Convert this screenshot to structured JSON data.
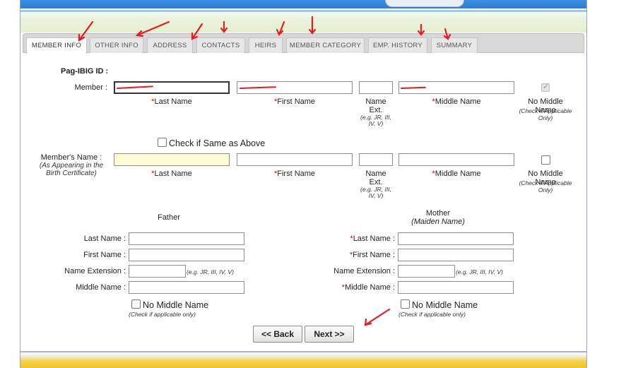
{
  "tabs": [
    {
      "label": "MEMBER INFO",
      "active": true
    },
    {
      "label": "OTHER INFO"
    },
    {
      "label": "ADDRESS"
    },
    {
      "label": "CONTACTS"
    },
    {
      "label": "HEIRS"
    },
    {
      "label": "MEMBER CATEGORY"
    },
    {
      "label": "EMP. HISTORY"
    },
    {
      "label": "SUMMARY"
    }
  ],
  "form": {
    "pagibig_label": "Pag-IBIG ID :",
    "member_label": "Member :",
    "member_values": {
      "last": "",
      "first": "",
      "ext": "",
      "middle": ""
    },
    "col_last": "Last Name",
    "col_first": "First Name",
    "col_ext": "Name Ext.",
    "col_ext_note": "(e.g. JR, III, IV, V)",
    "col_middle": "Middle Name",
    "req_mark": "*",
    "no_middle": "No Middle Name",
    "no_middle_note": "(Check if Applicable Only)",
    "same_as_above": "Check if Same as Above",
    "members_name_label": "Member's Name :",
    "members_name_note": "(As Appearing in the Birth Certificate)"
  },
  "parents": {
    "father_heading": "Father",
    "mother_heading": "Mother",
    "mother_note": "(Maiden Name)",
    "last_name": "Last Name :",
    "first_name": "First Name :",
    "name_ext": "Name Extension :",
    "middle_name": "Middle Name :",
    "ext_note": "(e.g. JR, III, IV, V)",
    "no_middle": "No Middle Name",
    "no_middle_note": "(Check if applicable only)"
  },
  "buttons": {
    "back": "<< Back",
    "next": "Next >>"
  },
  "colors": {
    "annotation_red": "#e8191f",
    "highlight_yellow": "#fffbd6",
    "header_blue": "#2d7dd0"
  },
  "icons": {
    "checkbox": "checkbox-icon",
    "arrow": "red-arrow-annotation"
  }
}
